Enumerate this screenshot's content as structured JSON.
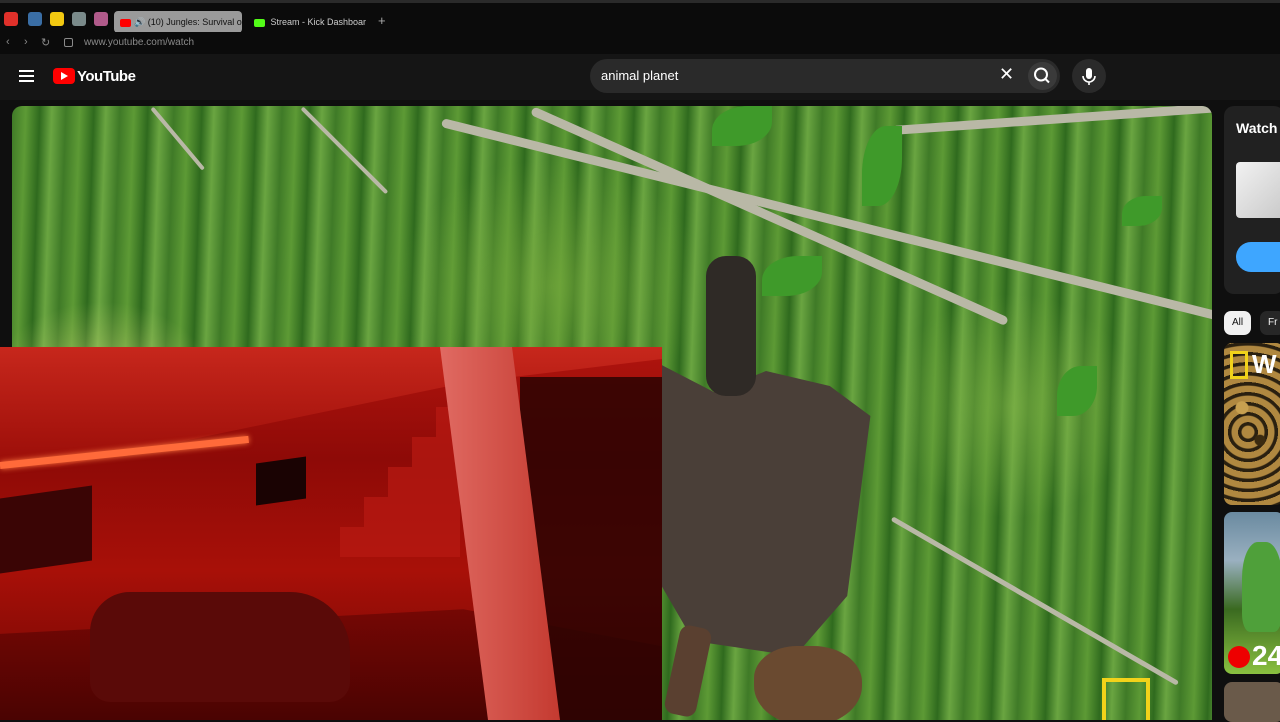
{
  "browser": {
    "pinned_tabs": [
      {
        "icon": "red-dot-icon",
        "color": "#e0302a"
      },
      {
        "icon": "mail-icon",
        "color": "#3a6ea5"
      },
      {
        "icon": "yellow-app-icon",
        "color": "#f2c811"
      },
      {
        "icon": "gray-app-icon",
        "color": "#7a8a8a"
      },
      {
        "icon": "circle-app-icon",
        "color": "#b05a8a"
      }
    ],
    "tabs": [
      {
        "label": "(10) Jungles: Survival o",
        "active": true,
        "icon": "youtube-icon"
      },
      {
        "label": "Stream - Kick Dashboar",
        "active": false,
        "icon": "kick-icon"
      }
    ],
    "new_tab": "+",
    "url": "www.youtube.com/watch"
  },
  "youtube": {
    "logo_text": "YouTube",
    "search_value": "animal planet",
    "clear_symbol": "✕"
  },
  "sidebar": {
    "card_title": "Watch",
    "chips": [
      "All",
      "Fr"
    ],
    "thumbs": [
      {
        "overlay_text": "W"
      },
      {
        "overlay_text": "24"
      }
    ]
  },
  "colors": {
    "accent": "#ff0000",
    "natgeo": "#f2d21a",
    "button_blue": "#3ea6ff"
  }
}
